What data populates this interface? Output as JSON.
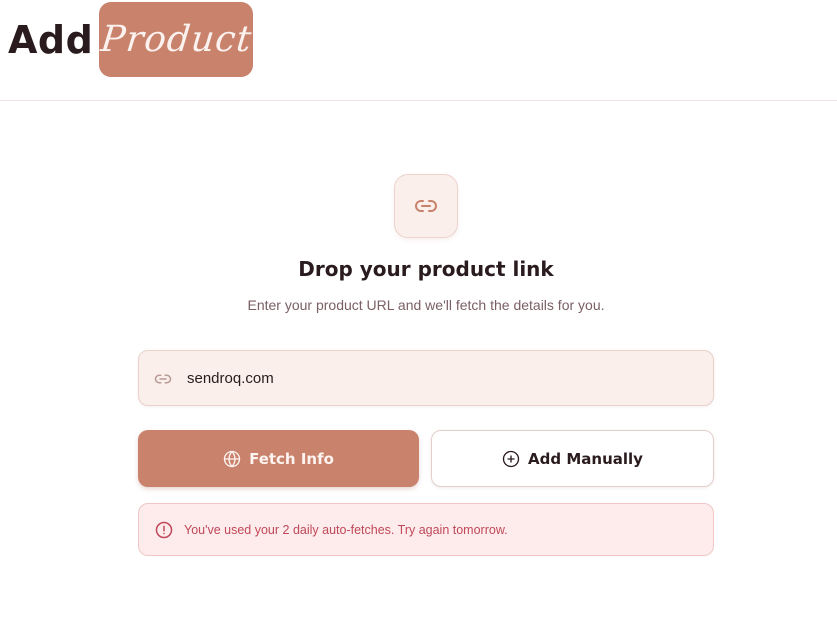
{
  "header": {
    "title_plain": "Add",
    "title_highlight": "Product"
  },
  "main": {
    "heading": "Drop your product link",
    "subheading": "Enter your product URL and we'll fetch the details for you.",
    "url_input": {
      "value": "sendroq.com",
      "icon": "link-icon"
    },
    "fetch_button": {
      "label": "Fetch Info",
      "icon": "globe-icon"
    },
    "manual_button": {
      "label": "Add Manually",
      "icon": "plus-circle-icon"
    },
    "alert": {
      "message": "You've used your 2 daily auto-fetches. Try again tomorrow.",
      "icon": "alert-circle-icon"
    }
  },
  "colors": {
    "accent": "#c9826b",
    "accent_light": "#fbefec",
    "error_text": "#c0485a",
    "error_bg": "#fdeceb"
  }
}
